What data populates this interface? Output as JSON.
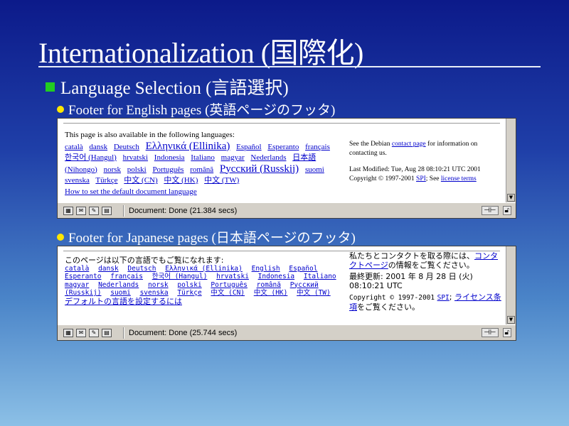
{
  "slide": {
    "title": "Internationalization (国際化)",
    "section": "Language Selection (言語選択)",
    "item1": "Footer for English pages (英語ページのフッタ)",
    "item2": "Footer for Japanese pages (日本語ページのフッタ)"
  },
  "english_footer": {
    "intro": "This page is also available in the following languages:",
    "languages": [
      "català",
      "dansk",
      "Deutsch",
      "Ελληνικά (Ellinika)",
      "Español",
      "Esperanto",
      "français",
      "한국어 (Hangul)",
      "hrvatski",
      "Indonesia",
      "Italiano",
      "magyar",
      "Nederlands",
      "日本語 (Nihongo)",
      "norsk",
      "polski",
      "Português",
      "română",
      "Русский (Russkij)",
      "suomi",
      "svenska",
      "Türkçe",
      "中文 (CN)",
      "中文 (HK)",
      "中文 (TW)"
    ],
    "default_link": "How to set the default document language",
    "contact_before": "See the Debian",
    "contact_link": "contact page",
    "contact_after": "for information on contacting us.",
    "last_modified": "Last Modified: Tue, Aug 28 08:10:21 UTC 2001",
    "copyright_before": "Copyright © 1997-2001",
    "spi": "SPI",
    "see": "; See",
    "license": "license terms",
    "status": "Document: Done (21.384 secs)"
  },
  "japanese_footer": {
    "intro": "このページは以下の言語でもご覧になれます:",
    "languages": [
      "català",
      "dansk",
      "Deutsch",
      "Ελληνικά (Ellinika)",
      "English",
      "Español",
      "Esperanto",
      "français",
      "한국어 (Hangul)",
      "hrvatski",
      "Indonesia",
      "Italiano",
      "magyar",
      "Nederlands",
      "norsk",
      "polski",
      "Português",
      "română",
      "Русский (Russkij)",
      "suomi",
      "svenska",
      "Türkçe",
      "中文 (CN)",
      "中文 (HK)",
      "中文 (TW)"
    ],
    "default_link": "デフォルトの言語を設定するには",
    "contact_before": "私たちとコンタクトを取る際には、",
    "contact_link": "コンタクトページ",
    "contact_after": "の情報をご覧ください。",
    "last_modified": "最終更新: 2001 年 8 月 28 日 (火) 08:10:21 UTC",
    "copyright_before": "Copyright © 1997-2001",
    "spi": "SPI",
    "license": "ライセンス条項",
    "license_after": "をご覧ください。",
    "status": "Document: Done (25.744 secs)"
  },
  "colors": {
    "bullet_square": "#22cc22",
    "bullet_dot": "#ffe600",
    "link": "#0000cc"
  }
}
